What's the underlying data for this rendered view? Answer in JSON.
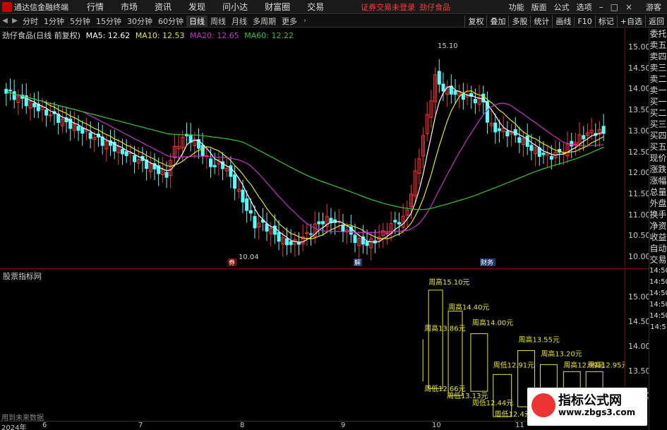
{
  "menubar": {
    "app_title": "通达信金融终端",
    "items": [
      "行情",
      "市场",
      "资讯",
      "发现",
      "问小达",
      "财富圈",
      "交易"
    ],
    "banner": "证券交易未登录",
    "stock_name": "劲仔食品",
    "right_items": [
      "功能",
      "版面",
      "公式",
      "选项"
    ],
    "guest_label": "游客"
  },
  "periodbar": {
    "periods": [
      "分时",
      "1分钟",
      "5分钟",
      "15分钟",
      "30分钟",
      "60分钟",
      "日线",
      "周线",
      "月线",
      "多周期",
      "更多"
    ],
    "active_period": "日线",
    "tools": [
      "复权",
      "叠加",
      "多股",
      "统计",
      "画线",
      "F10",
      "标记",
      "+自选",
      "返回"
    ]
  },
  "legend": {
    "title": "劲仔食品(日线 前复权)",
    "ma5": "MA5: 12.62",
    "ma10": "MA10: 12.53",
    "ma20": "MA20: 12.65",
    "ma60": "MA60: 12.22",
    "colors": {
      "ma5": "#ffffff",
      "ma10": "#e6e61e",
      "ma20": "#c832c8",
      "ma60": "#32c832"
    }
  },
  "main_axis": [
    "15.00",
    "14.50",
    "14.00",
    "13.50",
    "13.00",
    "12.50",
    "12.00",
    "11.50",
    "11.00",
    "10.50",
    "10.00"
  ],
  "annotations": {
    "high": "15.10",
    "low": "10.04"
  },
  "event_badges": [
    "券",
    "解",
    "财务"
  ],
  "side_panel": [
    "委托",
    "卖五",
    "卖四",
    "卖三",
    "卖二",
    "卖一",
    "买一",
    "买二",
    "买三",
    "买四",
    "买五",
    "现价",
    "涨跌",
    "涨幅",
    "总量",
    "外盘",
    "换手",
    "净资",
    "收益",
    "自动",
    "交易"
  ],
  "sub_chart": {
    "title": "股票指标网",
    "footer": "用到未来数据",
    "axis": [
      "15.00",
      "14.50",
      "14.00",
      "13.50",
      "13.00"
    ],
    "labels": [
      {
        "text": "周高15.10元"
      },
      {
        "text": "周高14.40元"
      },
      {
        "text": "周高13.86元"
      },
      {
        "text": "周高14.00元"
      },
      {
        "text": "周低13.13元"
      },
      {
        "text": "周高13.55元"
      },
      {
        "text": "周低12.91元"
      },
      {
        "text": "周高13.20元"
      },
      {
        "text": "周高12.99元"
      },
      {
        "text": "周高12.95元"
      },
      {
        "text": "周低12.44元"
      },
      {
        "text": "周低12.66元"
      },
      {
        "text": "周低12.4元"
      }
    ]
  },
  "side_times": [
    "14:50",
    "14:50",
    "14:50",
    "14:50",
    "14:50",
    "14:5"
  ],
  "time_axis": [
    "2024年",
    "6",
    "7",
    "8",
    "9",
    "10",
    "11"
  ],
  "watermark": {
    "title": "指标公式网",
    "url": "www.zbgs3.com"
  }
}
